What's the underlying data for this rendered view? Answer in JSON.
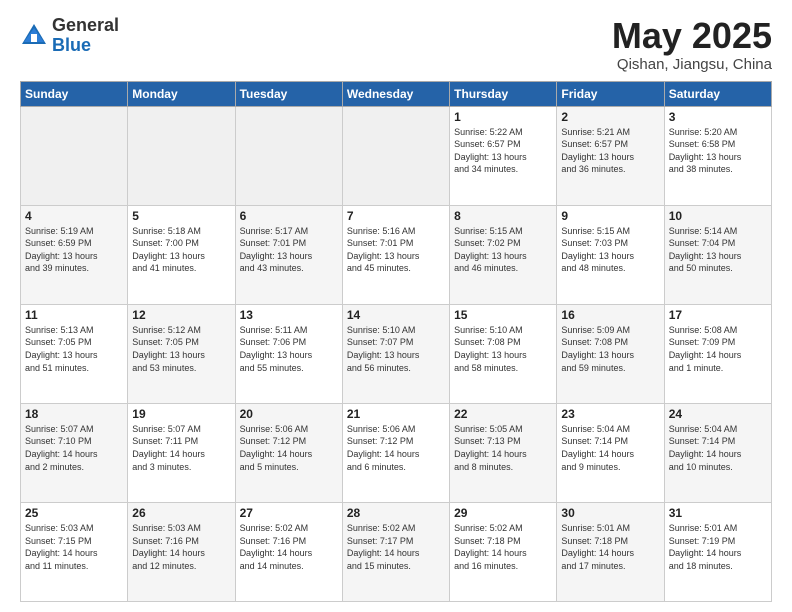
{
  "logo": {
    "general": "General",
    "blue": "Blue"
  },
  "header": {
    "month_year": "May 2025",
    "location": "Qishan, Jiangsu, China"
  },
  "days_of_week": [
    "Sunday",
    "Monday",
    "Tuesday",
    "Wednesday",
    "Thursday",
    "Friday",
    "Saturday"
  ],
  "weeks": [
    [
      {
        "day": "",
        "info": ""
      },
      {
        "day": "",
        "info": ""
      },
      {
        "day": "",
        "info": ""
      },
      {
        "day": "",
        "info": ""
      },
      {
        "day": "1",
        "info": "Sunrise: 5:22 AM\nSunset: 6:57 PM\nDaylight: 13 hours\nand 34 minutes."
      },
      {
        "day": "2",
        "info": "Sunrise: 5:21 AM\nSunset: 6:57 PM\nDaylight: 13 hours\nand 36 minutes."
      },
      {
        "day": "3",
        "info": "Sunrise: 5:20 AM\nSunset: 6:58 PM\nDaylight: 13 hours\nand 38 minutes."
      }
    ],
    [
      {
        "day": "4",
        "info": "Sunrise: 5:19 AM\nSunset: 6:59 PM\nDaylight: 13 hours\nand 39 minutes."
      },
      {
        "day": "5",
        "info": "Sunrise: 5:18 AM\nSunset: 7:00 PM\nDaylight: 13 hours\nand 41 minutes."
      },
      {
        "day": "6",
        "info": "Sunrise: 5:17 AM\nSunset: 7:01 PM\nDaylight: 13 hours\nand 43 minutes."
      },
      {
        "day": "7",
        "info": "Sunrise: 5:16 AM\nSunset: 7:01 PM\nDaylight: 13 hours\nand 45 minutes."
      },
      {
        "day": "8",
        "info": "Sunrise: 5:15 AM\nSunset: 7:02 PM\nDaylight: 13 hours\nand 46 minutes."
      },
      {
        "day": "9",
        "info": "Sunrise: 5:15 AM\nSunset: 7:03 PM\nDaylight: 13 hours\nand 48 minutes."
      },
      {
        "day": "10",
        "info": "Sunrise: 5:14 AM\nSunset: 7:04 PM\nDaylight: 13 hours\nand 50 minutes."
      }
    ],
    [
      {
        "day": "11",
        "info": "Sunrise: 5:13 AM\nSunset: 7:05 PM\nDaylight: 13 hours\nand 51 minutes."
      },
      {
        "day": "12",
        "info": "Sunrise: 5:12 AM\nSunset: 7:05 PM\nDaylight: 13 hours\nand 53 minutes."
      },
      {
        "day": "13",
        "info": "Sunrise: 5:11 AM\nSunset: 7:06 PM\nDaylight: 13 hours\nand 55 minutes."
      },
      {
        "day": "14",
        "info": "Sunrise: 5:10 AM\nSunset: 7:07 PM\nDaylight: 13 hours\nand 56 minutes."
      },
      {
        "day": "15",
        "info": "Sunrise: 5:10 AM\nSunset: 7:08 PM\nDaylight: 13 hours\nand 58 minutes."
      },
      {
        "day": "16",
        "info": "Sunrise: 5:09 AM\nSunset: 7:08 PM\nDaylight: 13 hours\nand 59 minutes."
      },
      {
        "day": "17",
        "info": "Sunrise: 5:08 AM\nSunset: 7:09 PM\nDaylight: 14 hours\nand 1 minute."
      }
    ],
    [
      {
        "day": "18",
        "info": "Sunrise: 5:07 AM\nSunset: 7:10 PM\nDaylight: 14 hours\nand 2 minutes."
      },
      {
        "day": "19",
        "info": "Sunrise: 5:07 AM\nSunset: 7:11 PM\nDaylight: 14 hours\nand 3 minutes."
      },
      {
        "day": "20",
        "info": "Sunrise: 5:06 AM\nSunset: 7:12 PM\nDaylight: 14 hours\nand 5 minutes."
      },
      {
        "day": "21",
        "info": "Sunrise: 5:06 AM\nSunset: 7:12 PM\nDaylight: 14 hours\nand 6 minutes."
      },
      {
        "day": "22",
        "info": "Sunrise: 5:05 AM\nSunset: 7:13 PM\nDaylight: 14 hours\nand 8 minutes."
      },
      {
        "day": "23",
        "info": "Sunrise: 5:04 AM\nSunset: 7:14 PM\nDaylight: 14 hours\nand 9 minutes."
      },
      {
        "day": "24",
        "info": "Sunrise: 5:04 AM\nSunset: 7:14 PM\nDaylight: 14 hours\nand 10 minutes."
      }
    ],
    [
      {
        "day": "25",
        "info": "Sunrise: 5:03 AM\nSunset: 7:15 PM\nDaylight: 14 hours\nand 11 minutes."
      },
      {
        "day": "26",
        "info": "Sunrise: 5:03 AM\nSunset: 7:16 PM\nDaylight: 14 hours\nand 12 minutes."
      },
      {
        "day": "27",
        "info": "Sunrise: 5:02 AM\nSunset: 7:16 PM\nDaylight: 14 hours\nand 14 minutes."
      },
      {
        "day": "28",
        "info": "Sunrise: 5:02 AM\nSunset: 7:17 PM\nDaylight: 14 hours\nand 15 minutes."
      },
      {
        "day": "29",
        "info": "Sunrise: 5:02 AM\nSunset: 7:18 PM\nDaylight: 14 hours\nand 16 minutes."
      },
      {
        "day": "30",
        "info": "Sunrise: 5:01 AM\nSunset: 7:18 PM\nDaylight: 14 hours\nand 17 minutes."
      },
      {
        "day": "31",
        "info": "Sunrise: 5:01 AM\nSunset: 7:19 PM\nDaylight: 14 hours\nand 18 minutes."
      }
    ]
  ]
}
